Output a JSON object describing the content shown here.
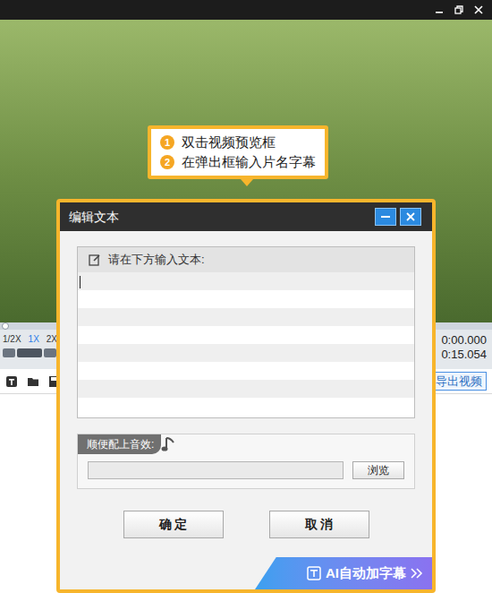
{
  "callout": {
    "steps": [
      {
        "number": "1",
        "text": "双击视频预览框"
      },
      {
        "number": "2",
        "text": "在弹出框输入片名字幕"
      }
    ]
  },
  "player": {
    "progress": {
      "level": 0
    },
    "speeds": [
      {
        "label": "1/2X",
        "selected": false
      },
      {
        "label": "1X",
        "selected": true
      },
      {
        "label": "2X",
        "selected": false
      }
    ],
    "current_time": "0:00.000",
    "total_time": "0:15.054",
    "export_button": "导出视频"
  },
  "dialog": {
    "title": "编辑文本",
    "text_prompt": "请在下方输入文本:",
    "sound_label": "顺便配上音效:",
    "browse_button": "浏览",
    "buttons": [
      "确 定",
      "取 消"
    ],
    "ai_banner": "AI自动加字幕"
  }
}
